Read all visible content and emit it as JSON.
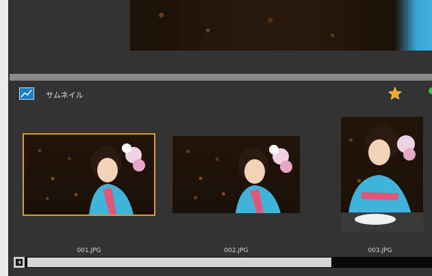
{
  "thumbnail_panel": {
    "title": "サムネイル",
    "title_icon": "thumbnail-view-icon",
    "favorite_icon": "star-icon",
    "accent_colors": {
      "selection": "#d4a23a",
      "star": "#f5a623",
      "status": "#3bbf4b"
    }
  },
  "thumbnails": [
    {
      "filename": "001.JPG",
      "selected": true
    },
    {
      "filename": "002.JPG",
      "selected": false
    },
    {
      "filename": "003.JPG",
      "selected": false
    }
  ],
  "scrollbar": {
    "left_arrow_icon": "scroll-left-arrow-icon",
    "position_fraction": 0.0,
    "visible_fraction": 0.73
  }
}
